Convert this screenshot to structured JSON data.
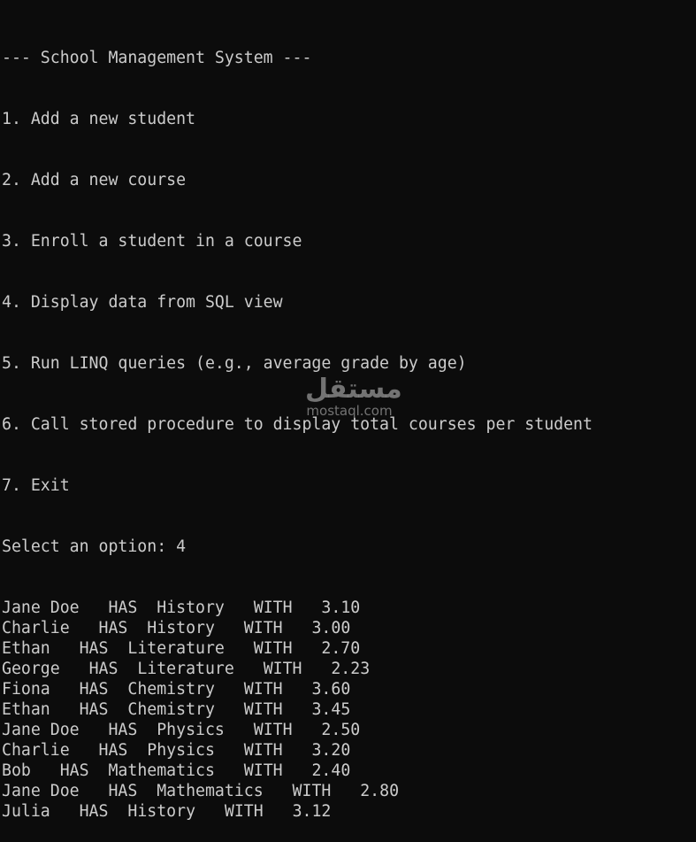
{
  "menu": {
    "title": "--- School Management System ---",
    "options": [
      "1. Add a new student",
      "2. Add a new course",
      "3. Enroll a student in a course",
      "4. Display data from SQL view",
      "5. Run LINQ queries (e.g., average grade by age)",
      "6. Call stored procedure to display total courses per student",
      "7. Exit"
    ],
    "prompt": "Select an option: 4"
  },
  "results": [
    {
      "name": "Jane Doe",
      "course": "History",
      "grade": "3.10"
    },
    {
      "name": "Charlie",
      "course": "History",
      "grade": "3.00"
    },
    {
      "name": "Ethan",
      "course": "Literature",
      "grade": "2.70"
    },
    {
      "name": "George",
      "course": "Literature",
      "grade": "2.23"
    },
    {
      "name": "Fiona",
      "course": "Chemistry",
      "grade": "3.60"
    },
    {
      "name": "Ethan",
      "course": "Chemistry",
      "grade": "3.45"
    },
    {
      "name": "Jane Doe",
      "course": "Physics",
      "grade": "2.50"
    },
    {
      "name": "Charlie",
      "course": "Physics",
      "grade": "3.20"
    },
    {
      "name": "Bob",
      "course": "Mathematics",
      "grade": "2.40"
    },
    {
      "name": "Jane Doe",
      "course": "Mathematics",
      "grade": "2.80"
    },
    {
      "name": "Julia",
      "course": "History",
      "grade": "3.12"
    }
  ],
  "keywords": {
    "has": "HAS",
    "with": "WITH"
  },
  "watermark": {
    "arabic": "مستقل",
    "text": "mostaql.com"
  }
}
